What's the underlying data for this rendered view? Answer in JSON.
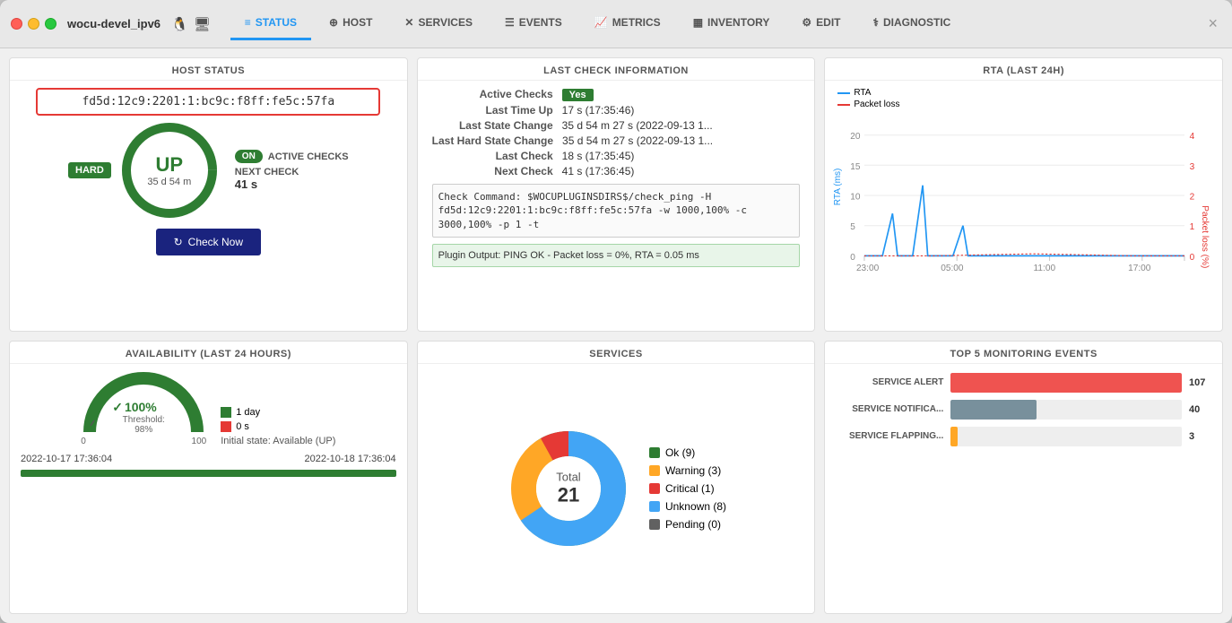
{
  "window": {
    "host": "wocu-devel_ipv6",
    "close_label": "×"
  },
  "navbar": {
    "tabs": [
      {
        "id": "status",
        "label": "STATUS",
        "icon": "≡",
        "active": true
      },
      {
        "id": "host",
        "label": "HOST",
        "icon": "⊕"
      },
      {
        "id": "services",
        "label": "SERVICES",
        "icon": "✕"
      },
      {
        "id": "events",
        "label": "EVENTS",
        "icon": "☰"
      },
      {
        "id": "metrics",
        "label": "METRICS",
        "icon": "📈"
      },
      {
        "id": "inventory",
        "label": "INVENTORY",
        "icon": "▦"
      },
      {
        "id": "edit",
        "label": "EDIT",
        "icon": "⚙"
      },
      {
        "id": "diagnostic",
        "label": "DIAGNOSTIC",
        "icon": "⚕"
      }
    ]
  },
  "host_status": {
    "title": "HOST STATUS",
    "ip": "fd5d:12c9:2201:1:bc9c:f8ff:fe5c:57fa",
    "state": "UP",
    "duration": "35 d 54 m",
    "hard_label": "HARD",
    "active_checks_label": "ACTIVE CHECKS",
    "toggle_label": "ON",
    "next_check_label": "NEXT CHECK",
    "next_check_value": "41 s",
    "check_now": "Check Now"
  },
  "last_check": {
    "title": "LAST CHECK INFORMATION",
    "rows": [
      {
        "label": "Active Checks",
        "value": "Yes",
        "type": "badge"
      },
      {
        "label": "Last Time Up",
        "value": "17 s (17:35:46)"
      },
      {
        "label": "Last State Change",
        "value": "35 d 54 m 27 s (2022-09-13 1..."
      },
      {
        "label": "Last Hard State Change",
        "value": "35 d 54 m 27 s (2022-09-13 1..."
      },
      {
        "label": "Last Check",
        "value": "18 s (17:35:45)"
      },
      {
        "label": "Next Check",
        "value": "41 s (17:36:45)"
      }
    ],
    "command": "Check Command: $WOCUPLUGINSDIRS$/check_ping -H fd5d:12c9:2201:1:bc9c:f8ff:fe5c:57fa -w 1000,100% -c 3000,100% -p 1 -t",
    "plugin_output": "Plugin Output: PING OK - Packet loss = 0%, RTA = 0.05 ms"
  },
  "rta": {
    "title": "RTA (LAST 24H)",
    "legend": {
      "rta": "RTA",
      "packet_loss": "Packet loss"
    },
    "y_left_max": 20,
    "y_right_max": 4,
    "x_labels": [
      "23:00",
      "05:00",
      "11:00",
      "17:00"
    ]
  },
  "availability": {
    "title": "AVAILABILITY (LAST 24 HOURS)",
    "legend": [
      {
        "color": "green",
        "label": "1 day"
      },
      {
        "color": "red",
        "label": "0 s"
      }
    ],
    "initial_state": "Initial state: Available (UP)",
    "percentage": "100%",
    "threshold": "Threshold: 98%",
    "gauge_labels": [
      "0",
      "100"
    ],
    "date_start": "2022-10-17 17:36:04",
    "date_end": "2022-10-18 17:36:04"
  },
  "services": {
    "title": "SERVICES",
    "total_label": "Total",
    "total": "21",
    "segments": [
      {
        "label": "Ok (9)",
        "color": "#2e7d32",
        "value": 9
      },
      {
        "label": "Warning (3)",
        "color": "#ffa726",
        "value": 3
      },
      {
        "label": "Critical (1)",
        "color": "#e53935",
        "value": 1
      },
      {
        "label": "Unknown (8)",
        "color": "#42a5f5",
        "value": 8
      },
      {
        "label": "Pending (0)",
        "color": "#616161",
        "value": 0
      }
    ]
  },
  "top5": {
    "title": "TOP 5 MONITORING EVENTS",
    "items": [
      {
        "label": "SERVICE ALERT",
        "value": 107,
        "color": "#ef5350",
        "max": 107
      },
      {
        "label": "SERVICE NOTIFICA...",
        "value": 40,
        "color": "#78909c",
        "max": 107
      },
      {
        "label": "SERVICE FLAPPING...",
        "value": 3,
        "color": "#ffa726",
        "max": 107
      }
    ]
  }
}
